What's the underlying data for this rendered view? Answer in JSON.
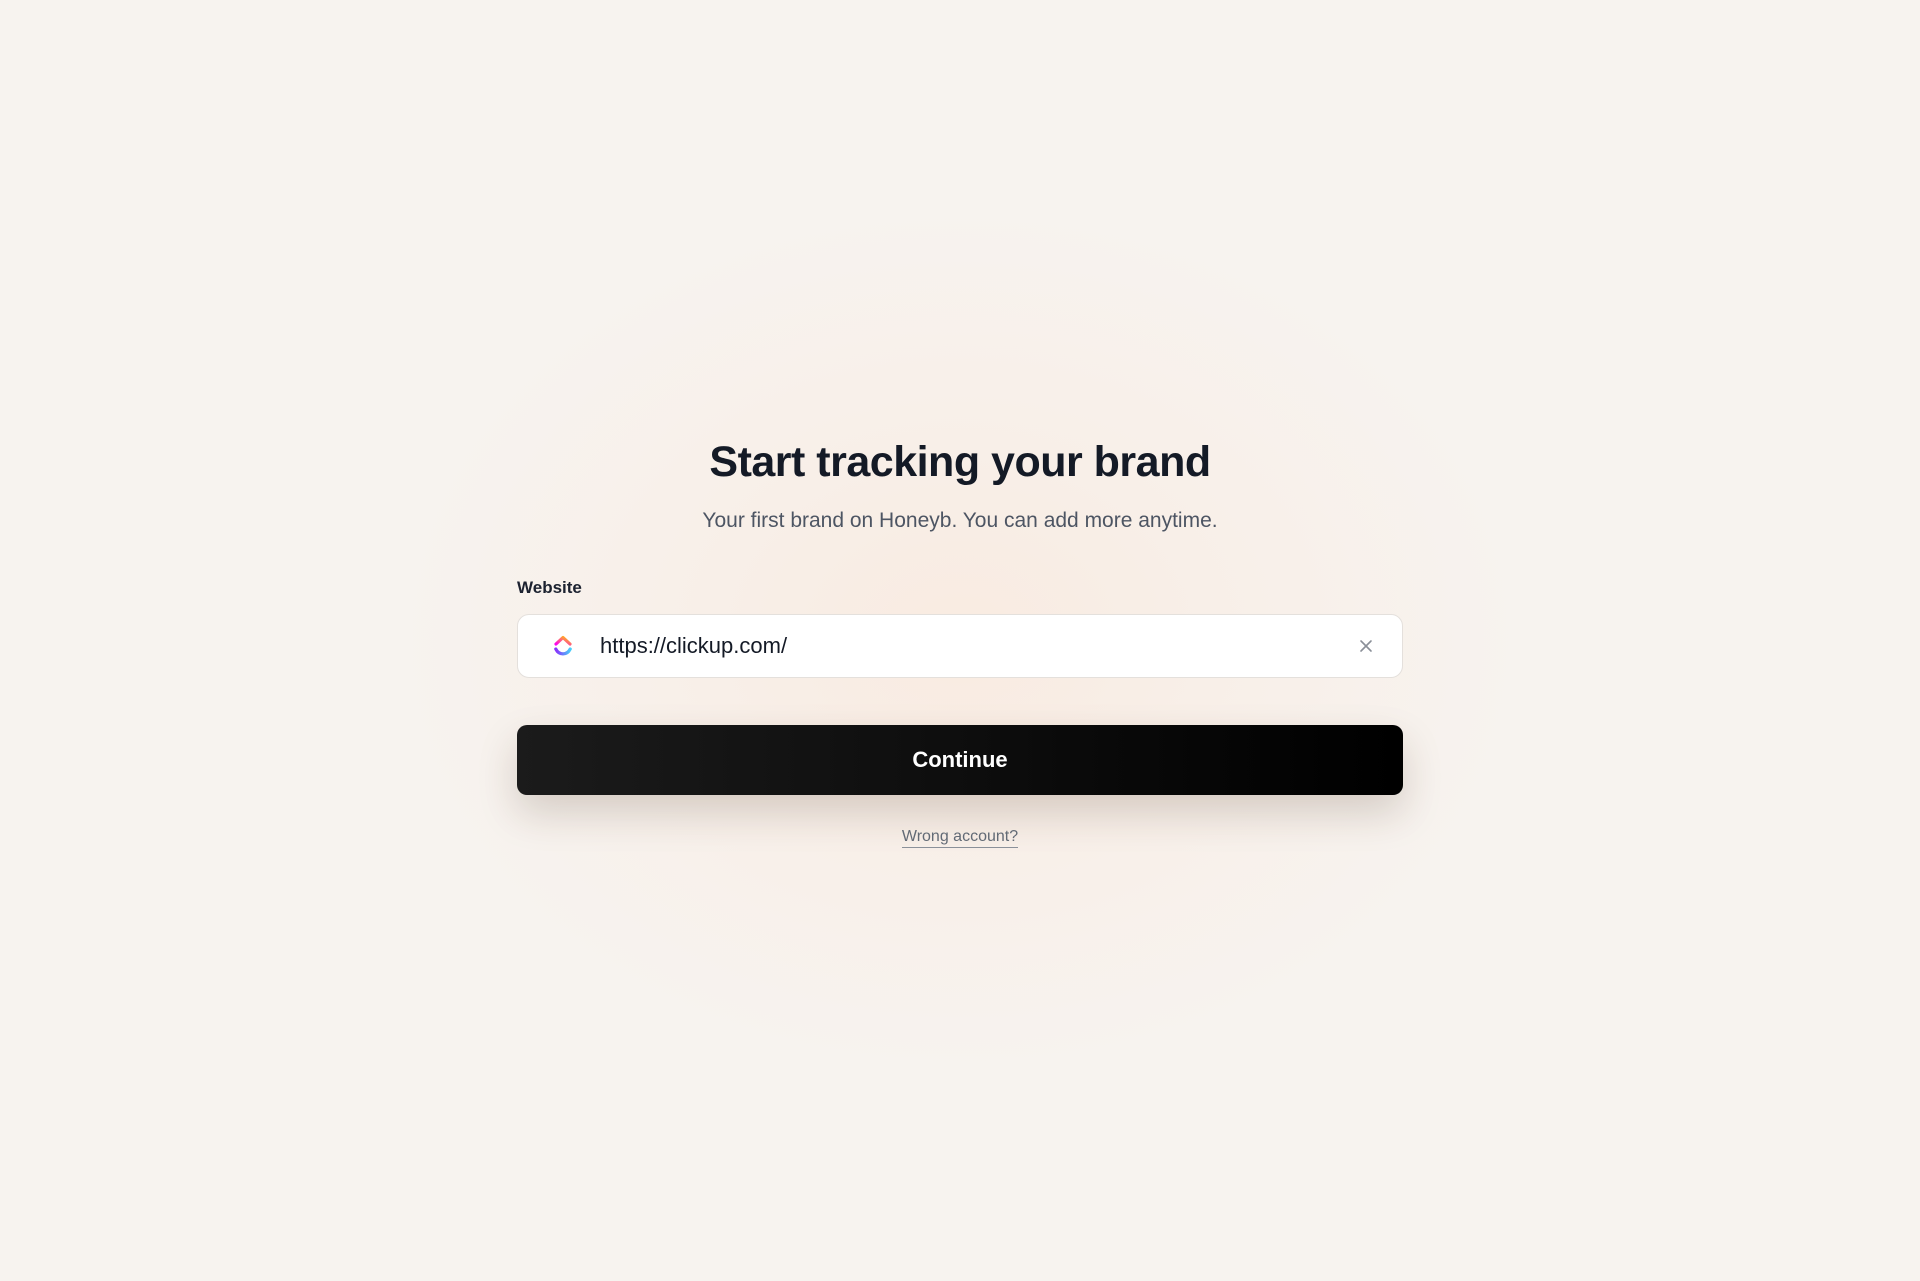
{
  "page": {
    "title": "Start tracking your brand",
    "subtitle": "Your first brand on Honeyb. You can add more anytime."
  },
  "form": {
    "website_label": "Website",
    "website_value": "https://clickup.com/",
    "favicon_icon": "clickup-logo-icon",
    "clear_icon": "close-icon",
    "continue_label": "Continue"
  },
  "footer": {
    "wrong_account_label": "Wrong account?"
  },
  "colors": {
    "background": "#f7f3ef",
    "title": "#141a26",
    "button": "#0d0d0d",
    "button_text": "#ffffff"
  }
}
